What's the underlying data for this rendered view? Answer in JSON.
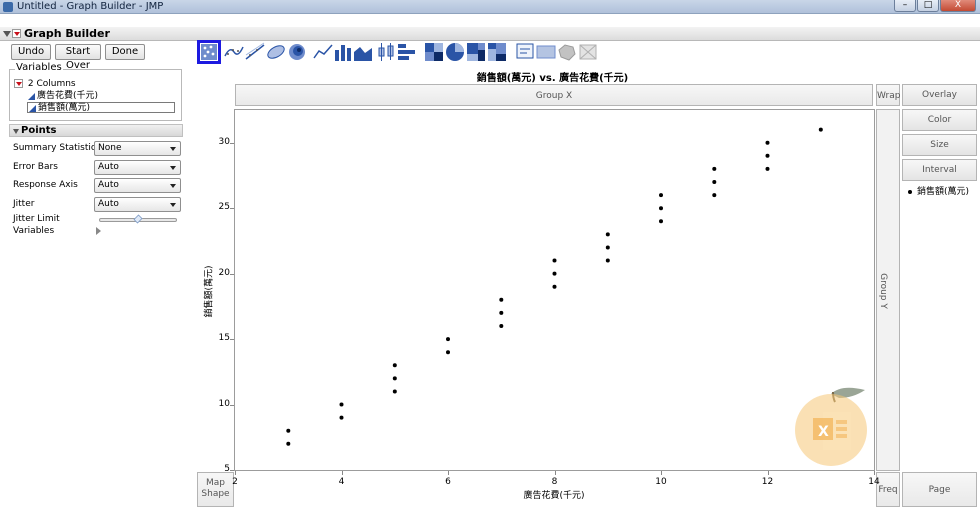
{
  "window": {
    "title": "Untitled - Graph Builder - JMP",
    "buttons": [
      "–",
      "□",
      "X"
    ]
  },
  "header": {
    "title": "Graph Builder"
  },
  "actions": {
    "undo": "Undo",
    "start_over": "Start Over",
    "done": "Done"
  },
  "variables": {
    "caption": "Variables",
    "columns_label": "2 Columns",
    "items": [
      "廣告花費(千元)",
      "銷售額(萬元)"
    ]
  },
  "points": {
    "title": "Points",
    "summary_label": "Summary Statistic",
    "summary_value": "None",
    "error_label": "Error Bars",
    "error_value": "Auto",
    "response_label": "Response Axis",
    "response_value": "Auto",
    "jitter_label": "Jitter",
    "jitter_value": "Auto",
    "jitter_limit_label": "Jitter Limit",
    "jitter_limit_level": 0.5,
    "variables_label": "Variables"
  },
  "toolbar": {
    "icons": [
      "points-icon",
      "smoother-icon",
      "line-of-fit-icon",
      "ellipse-icon",
      "contour-icon",
      "line-icon",
      "bar-icon",
      "area-icon",
      "box-plot-icon",
      "histogram-icon",
      "heatmap-icon",
      "pie-icon",
      "treemap-icon",
      "mosaic-icon",
      "caption-box-icon",
      "formula-icon",
      "map-shapes-icon",
      "map-disabled-icon"
    ],
    "selected": "points-icon"
  },
  "zones": {
    "group_x": "Group X",
    "wrap": "Wrap",
    "group_y": "Group Y",
    "overlay": "Overlay",
    "color": "Color",
    "size": "Size",
    "interval": "Interval",
    "map_shape_1": "Map",
    "map_shape_2": "Shape",
    "freq": "Freq",
    "page": "Page"
  },
  "legend": {
    "item": "銷售額(萬元)"
  },
  "accent_color": "#1d1ae0",
  "chart_data": {
    "type": "scatter",
    "title": "銷售額(萬元) vs. 廣告花費(千元)",
    "xlabel": "廣告花費(千元)",
    "ylabel": "銷售額(萬元)",
    "xlim": [
      2,
      14
    ],
    "ylim": [
      5,
      32.5
    ],
    "xticks": [
      2,
      4,
      6,
      8,
      10,
      12,
      14
    ],
    "yticks": [
      5,
      10,
      15,
      20,
      25,
      30
    ],
    "grid": false,
    "legend_position": "right",
    "series": [
      {
        "name": "銷售額(萬元)",
        "points": [
          [
            3,
            7
          ],
          [
            3,
            8
          ],
          [
            4,
            9
          ],
          [
            4,
            10
          ],
          [
            5,
            11
          ],
          [
            5,
            12
          ],
          [
            5,
            13
          ],
          [
            6,
            14
          ],
          [
            6,
            15
          ],
          [
            7,
            16
          ],
          [
            7,
            17
          ],
          [
            7,
            18
          ],
          [
            8,
            19
          ],
          [
            8,
            20
          ],
          [
            8,
            21
          ],
          [
            9,
            21
          ],
          [
            9,
            22
          ],
          [
            9,
            23
          ],
          [
            10,
            24
          ],
          [
            10,
            25
          ],
          [
            10,
            26
          ],
          [
            11,
            26
          ],
          [
            11,
            27
          ],
          [
            11,
            28
          ],
          [
            12,
            28
          ],
          [
            12,
            29
          ],
          [
            12,
            30
          ],
          [
            13,
            31
          ]
        ]
      }
    ]
  }
}
